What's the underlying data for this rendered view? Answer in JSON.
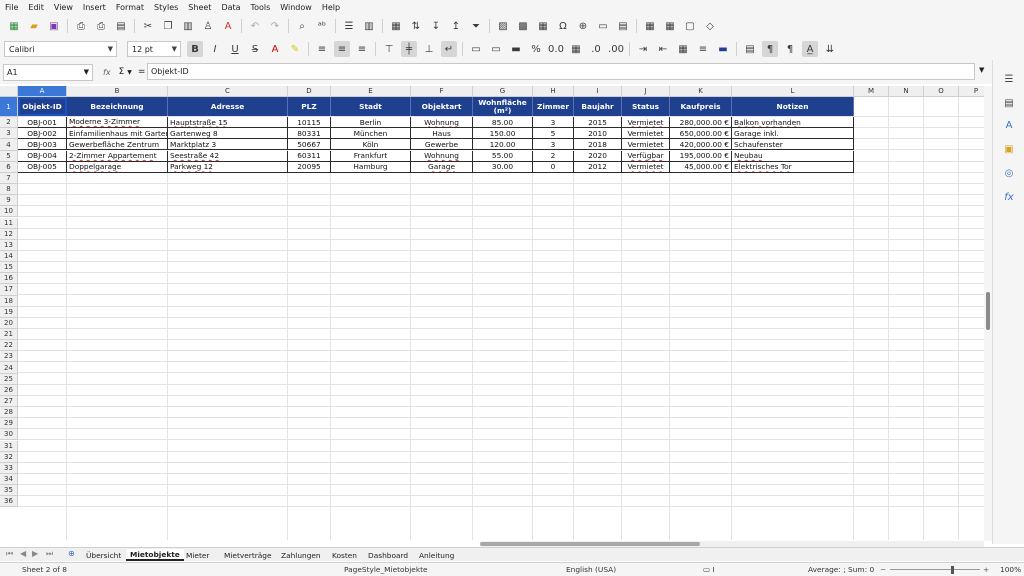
{
  "menu": [
    "File",
    "Edit",
    "View",
    "Insert",
    "Format",
    "Styles",
    "Sheet",
    "Data",
    "Tools",
    "Window",
    "Help"
  ],
  "toolbar": {
    "font_name": "Calibri",
    "font_size": "12 pt",
    "bold": "B",
    "italic": "I",
    "underline": "U",
    "percent": "%",
    "decimals": "0.0"
  },
  "formula_bar": {
    "name_box": "A1",
    "fx": "fx",
    "sigma": "Σ",
    "equals": "=",
    "content": "Objekt-ID"
  },
  "columns": [
    "A",
    "B",
    "C",
    "D",
    "E",
    "F",
    "G",
    "H",
    "I",
    "J",
    "K",
    "L",
    "M",
    "N",
    "O",
    "P"
  ],
  "rows": [
    "1",
    "2",
    "3",
    "4",
    "5",
    "6",
    "7",
    "8",
    "9",
    "10",
    "11",
    "12",
    "13",
    "14",
    "15",
    "16",
    "17",
    "18",
    "19",
    "20",
    "21",
    "22",
    "23",
    "24",
    "25",
    "26",
    "27",
    "28",
    "29",
    "30",
    "31",
    "32",
    "33",
    "34",
    "35",
    "36"
  ],
  "headers": [
    "Objekt-ID",
    "Bezeichnung",
    "Adresse",
    "PLZ",
    "Stadt",
    "Objektart",
    "Wohnfläche (m²)",
    "Zimmer",
    "Baujahr",
    "Status",
    "Kaufpreis",
    "Notizen"
  ],
  "table": [
    [
      "OBJ-001",
      "Moderne 3-Zimmer Wohnung",
      "Hauptstraße 15",
      "10115",
      "Berlin",
      "Wohnung",
      "85.00",
      "3",
      "2015",
      "Vermietet",
      "280,000.00 €",
      "Balkon vorhanden"
    ],
    [
      "OBJ-002",
      "Einfamilienhaus mit Garten",
      "Gartenweg 8",
      "80331",
      "München",
      "Haus",
      "150.00",
      "5",
      "2010",
      "Vermietet",
      "650,000.00 €",
      "Garage inkl."
    ],
    [
      "OBJ-003",
      "Gewerbefläche Zentrum",
      "Marktplatz 3",
      "50667",
      "Köln",
      "Gewerbe",
      "120.00",
      "3",
      "2018",
      "Vermietet",
      "420,000.00 €",
      "Schaufenster"
    ],
    [
      "OBJ-004",
      "2-Zimmer Appartement",
      "Seestraße 42",
      "60311",
      "Frankfurt",
      "Wohnung",
      "55.00",
      "2",
      "2020",
      "Verfügbar",
      "195,000.00 €",
      "Neubau"
    ],
    [
      "OBJ-005",
      "Doppelgarage",
      "Parkweg 12",
      "20095",
      "Hamburg",
      "Garage",
      "30.00",
      "0",
      "2012",
      "Vermietet",
      "45,000.00 €",
      "Elektrisches Tor"
    ]
  ],
  "sheet_tabs": [
    "Übersicht",
    "Mietobjekte",
    "Mieter",
    "Mietverträge",
    "Zahlungen",
    "Kosten",
    "Dashboard",
    "Anleitung"
  ],
  "active_tab": "Mietobjekte",
  "status": {
    "sheet": "Sheet 2 of 8",
    "page_style": "PageStyle_Mietobjekte",
    "language": "English (USA)",
    "summary": "Average: ; Sum: 0",
    "zoom": "100%"
  },
  "colors": {
    "header_bg": "#1f3f8f",
    "selection": "#3c78d8",
    "spell_error": "#d04040"
  }
}
